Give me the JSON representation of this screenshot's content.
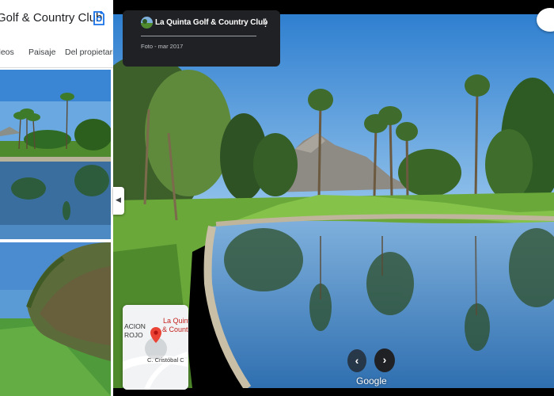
{
  "left_panel": {
    "title": "Golf & Country Club",
    "save_icon": "photo-save-icon",
    "tabs": [
      "deos",
      "Paisaje",
      "Del propietario"
    ]
  },
  "info_card": {
    "title": "La Quinta Golf & Country Club",
    "menu_icon": "more-vert-icon",
    "date": "Foto - mar 2017"
  },
  "minimap": {
    "left_label_1": "ACION",
    "left_label_2": "ROJO",
    "place_line_1": "La Quinta",
    "place_line_2": "& Countr",
    "street": "C. Cristóbal C"
  },
  "viewer": {
    "prev_icon": "chevron-left-icon",
    "next_icon": "chevron-right-icon",
    "collapse_icon": "chevron-left-icon",
    "logo": "Google"
  },
  "colors": {
    "card_bg": "#202124",
    "accent_green": "#5f8f3a",
    "sky": "#4a8fd6",
    "pin_red": "#ea4335"
  }
}
